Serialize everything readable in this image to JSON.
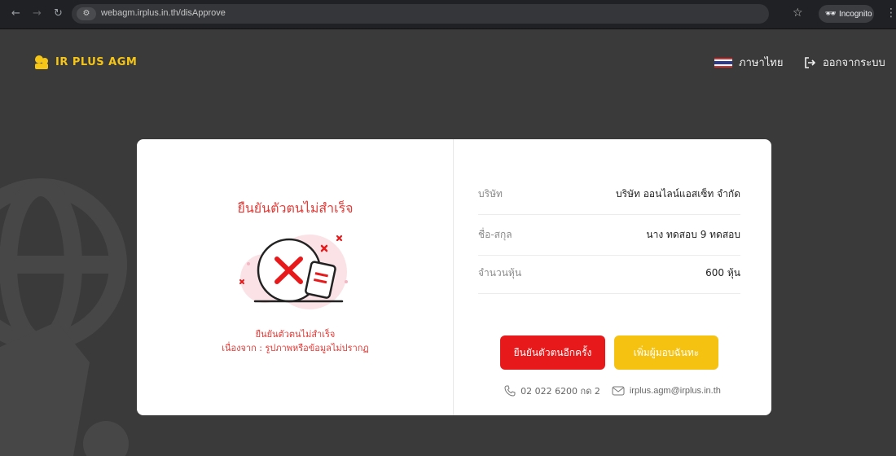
{
  "browser": {
    "url": "webagm.irplus.in.th/disApprove",
    "incognito_label": "Incognito"
  },
  "header": {
    "logo_text": "IR PLUS AGM",
    "language_label": "ภาษาไทย",
    "logout_label": "ออกจากระบบ"
  },
  "verification": {
    "title": "ยืนยันตัวตนไม่สำเร็จ",
    "message_line1": "ยืนยันตัวตนไม่สำเร็จ",
    "message_line2": "เนื่องจาก : รูปภาพหรือข้อมูลไม่ปรากฏ"
  },
  "details": {
    "rows": [
      {
        "label": "บริษัท",
        "value": "บริษัท ออนไลน์แอสเซ็ท จำกัด"
      },
      {
        "label": "ชื่อ-สกุล",
        "value": "นาง ทดสอบ 9 ทดสอบ"
      },
      {
        "label": "จำนวนหุ้น",
        "value": "600 หุ้น"
      }
    ]
  },
  "actions": {
    "retry_label": "ยืนยันตัวตนอีกครั้ง",
    "add_proxy_label": "เพิ่มผู้มอบฉันทะ"
  },
  "contact": {
    "phone": "02 022 6200 กด 2",
    "email": "irplus.agm@irplus.in.th"
  },
  "colors": {
    "accent_red": "#e8191b",
    "accent_yellow": "#f5c211",
    "logo_yellow": "#f5c518",
    "background": "#3a3a3a"
  },
  "icons": [
    "back-icon",
    "forward-icon",
    "reload-icon",
    "site-info-icon",
    "bookmark-star-icon",
    "incognito-icon",
    "menu-kebab-icon",
    "thai-flag-icon",
    "logout-icon",
    "phone-icon",
    "mail-icon"
  ]
}
